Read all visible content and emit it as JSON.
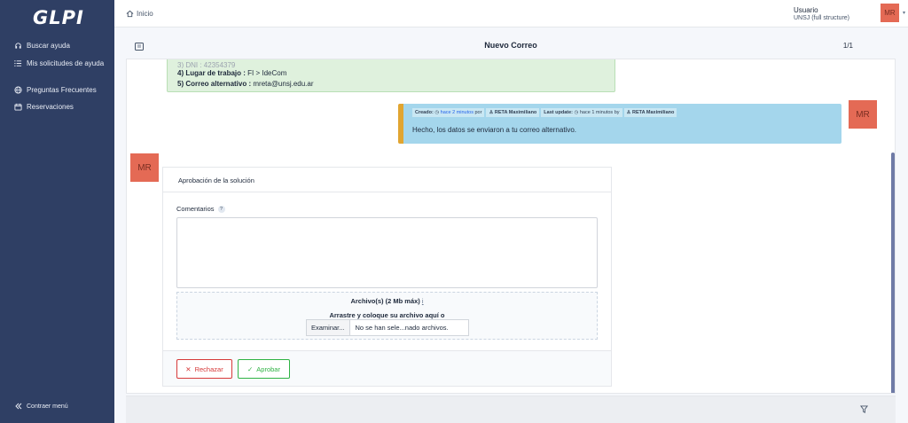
{
  "app": {
    "logo": "GLPI"
  },
  "sidebar": {
    "items": [
      {
        "label": "Buscar ayuda",
        "icon": "headset-icon"
      },
      {
        "label": "Mis solicitudes de ayuda",
        "icon": "list-icon"
      },
      {
        "label": "Preguntas Frecuentes",
        "icon": "globe-icon"
      },
      {
        "label": "Reservaciones",
        "icon": "calendar-icon"
      }
    ],
    "collapse_label": "Contraer menú"
  },
  "topbar": {
    "breadcrumb": "Inicio",
    "user_name": "Usuario",
    "user_entity": "UNSJ (full structure)",
    "avatar_initials": "MR"
  },
  "header": {
    "title": "Nuevo Correo",
    "count": "1/1"
  },
  "timeline": {
    "followup_fields": [
      {
        "label": "4) Lugar de trabajo :",
        "value": " FI > IdeCom"
      },
      {
        "label": "5) Correo alternativo :",
        "value": " mreta@unsj.edu.ar"
      }
    ],
    "partial_line": "3) DNI : 42354379",
    "solution": {
      "created_label": "Creado:",
      "created_time": "hace 2 minutos",
      "by_label": "por",
      "author": "RETA Maximiliano",
      "update_label": "Last update:",
      "update_time": "hace 1 minutos by",
      "update_author": "RETA Maximiliano",
      "message": "Hecho, los datos se enviaron a tu correo alternativo."
    },
    "avatar_right": "MR",
    "avatar_left": "MR"
  },
  "approval": {
    "title": "Aprobación de la solución",
    "comments_label": "Comentarios",
    "help_glyph": "?",
    "files_label": "Archivo(s) (2 Mb máx)",
    "info_glyph": "i",
    "drop_label": "Arrastre y coloque su archivo aquí o",
    "browse_button": "Examinar...",
    "no_file_text": "No se han sele...nado archivos.",
    "reject_button": "Rechazar",
    "approve_button": "Aprobar"
  },
  "colors": {
    "sidebar_bg": "#2f3f64",
    "avatar": "#e46a55",
    "solution_bg": "#a4d6ec",
    "solution_accent": "#e1a531",
    "followup_bg": "#dff1dd",
    "reject": "#d63939",
    "approve": "#2fb344"
  }
}
